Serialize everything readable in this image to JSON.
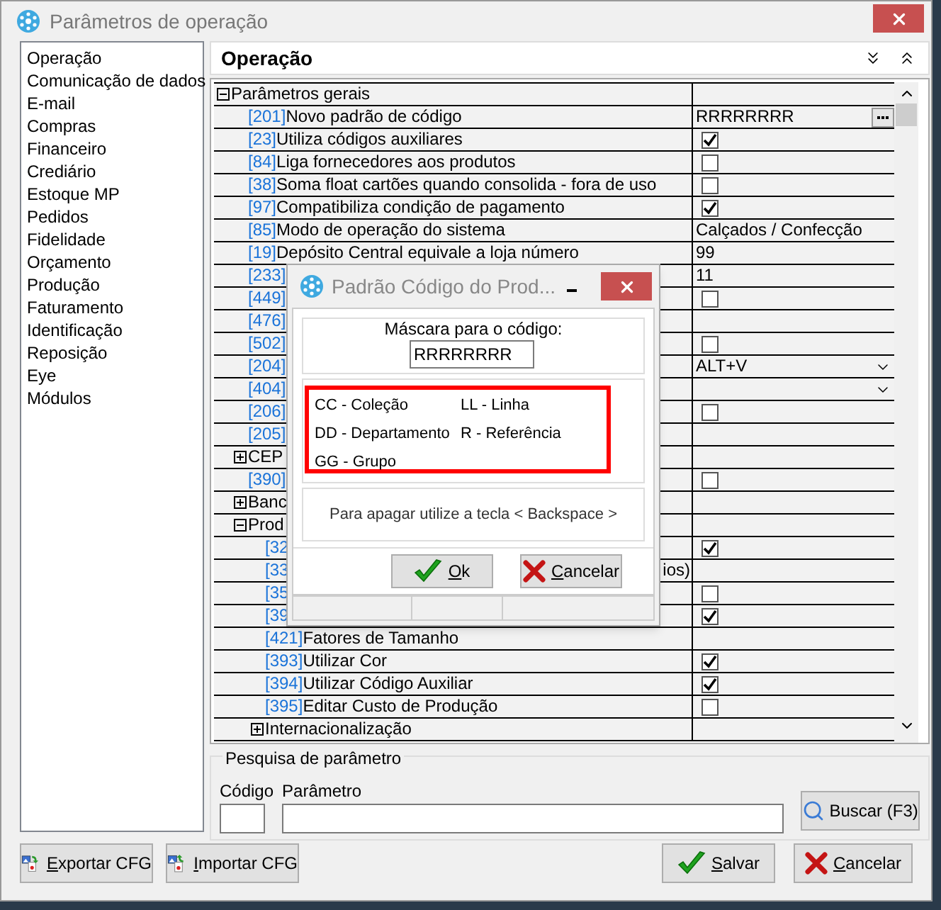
{
  "window": {
    "title": "Parâmetros de operação"
  },
  "sidebar": {
    "items": [
      "Operação",
      "Comunicação de dados",
      "E-mail",
      "Compras",
      "Financeiro",
      "Crediário",
      "Estoque MP",
      "Pedidos",
      "Fidelidade",
      "Orçamento",
      "Produção",
      "Faturamento",
      "Identificação",
      "Reposição",
      "Eye",
      "Módulos"
    ]
  },
  "panel": {
    "title": "Operação"
  },
  "tree": [
    {
      "kind": "group",
      "label": "Parâmetros gerais",
      "expanded": true,
      "children": [
        {
          "kind": "param",
          "code": "[201]",
          "label": "Novo padrão de código",
          "value": {
            "kind": "ellipsis",
            "text": "RRRRRRRR"
          }
        },
        {
          "kind": "param",
          "code": "[23]",
          "label": "Utiliza códigos auxiliares",
          "value": {
            "kind": "checkbox",
            "checked": true
          }
        },
        {
          "kind": "param",
          "code": "[84]",
          "label": "Liga fornecedores aos produtos",
          "value": {
            "kind": "checkbox",
            "checked": false
          }
        },
        {
          "kind": "param",
          "code": "[38]",
          "label": "Soma float cartões quando consolida - fora de uso",
          "value": {
            "kind": "checkbox",
            "checked": false
          }
        },
        {
          "kind": "param",
          "code": "[97]",
          "label": "Compatibiliza condição de pagamento",
          "value": {
            "kind": "checkbox",
            "checked": true
          }
        },
        {
          "kind": "param",
          "code": "[85]",
          "label": "Modo de operação do sistema",
          "value": {
            "kind": "text",
            "text": "Calçados / Confecção"
          }
        },
        {
          "kind": "param",
          "code": "[19]",
          "label": "Depósito Central equivale a loja número",
          "value": {
            "kind": "text",
            "text": "99"
          }
        },
        {
          "kind": "param",
          "code": "[233]",
          "value": {
            "kind": "text",
            "text": "11"
          }
        },
        {
          "kind": "param",
          "code": "[449]",
          "value": {
            "kind": "checkbox",
            "checked": false
          }
        },
        {
          "kind": "param",
          "code": "[476]"
        },
        {
          "kind": "param",
          "code": "[502]",
          "value": {
            "kind": "checkbox",
            "checked": false
          }
        },
        {
          "kind": "param",
          "code": "[204]",
          "value": {
            "kind": "dropdown",
            "text": "ALT+V"
          }
        },
        {
          "kind": "param",
          "code": "[404]",
          "value": {
            "kind": "dropdown"
          }
        },
        {
          "kind": "param",
          "code": "[206]",
          "value": {
            "kind": "checkbox",
            "checked": false
          }
        },
        {
          "kind": "param",
          "code": "[205]"
        },
        {
          "kind": "group",
          "label": "CEP",
          "expanded": false
        },
        {
          "kind": "param",
          "code": "[390]",
          "value": {
            "kind": "checkbox",
            "checked": false
          }
        },
        {
          "kind": "group",
          "label": "Banc",
          "expanded": false
        },
        {
          "kind": "group",
          "label": "Prod",
          "expanded": true,
          "children": [
            {
              "kind": "param",
              "code": "[32",
              "value": {
                "kind": "checkbox",
                "checked": true
              }
            },
            {
              "kind": "param",
              "code": "[33",
              "tail": "ios)"
            },
            {
              "kind": "param",
              "code": "[35",
              "value": {
                "kind": "checkbox",
                "checked": false
              }
            },
            {
              "kind": "param",
              "code": "[39",
              "value": {
                "kind": "checkbox",
                "checked": true
              }
            },
            {
              "kind": "param",
              "code": "[421]",
              "label": "Fatores de Tamanho"
            },
            {
              "kind": "param",
              "code": "[393]",
              "label": "Utilizar Cor",
              "value": {
                "kind": "checkbox",
                "checked": true
              }
            },
            {
              "kind": "param",
              "code": "[394]",
              "label": "Utilizar Código Auxiliar",
              "value": {
                "kind": "checkbox",
                "checked": true
              }
            },
            {
              "kind": "param",
              "code": "[395]",
              "label": "Editar Custo de Produção",
              "value": {
                "kind": "checkbox",
                "checked": false
              }
            },
            {
              "kind": "group",
              "label": "Internacionalização",
              "expanded": false
            }
          ]
        }
      ]
    }
  ],
  "search": {
    "legend": "Pesquisa de parâmetro",
    "code_label": "Código",
    "param_label": "Parâmetro",
    "button": "Buscar (F3)"
  },
  "footer": {
    "buttons": [
      {
        "label": "Exportar CFG",
        "kind": "export"
      },
      {
        "label": "Importar CFG",
        "kind": "import"
      },
      {
        "label": "Salvar",
        "kind": "ok"
      },
      {
        "label": "Cancelar",
        "kind": "cancel"
      }
    ]
  },
  "dialog": {
    "title": "Padrão Código do Prod...",
    "mask_label": "Máscara para o código:",
    "mask_value": "RRRRRRRR",
    "legend": [
      "CC - Coleção",
      "LL - Linha",
      "DD - Departamento",
      "R - Referência",
      "GG - Grupo"
    ],
    "hint": "Para apagar utilize a tecla < Backspace >",
    "buttons": [
      {
        "label": "Ok",
        "kind": "ok"
      },
      {
        "label": "Cancelar",
        "kind": "cancel"
      }
    ]
  }
}
